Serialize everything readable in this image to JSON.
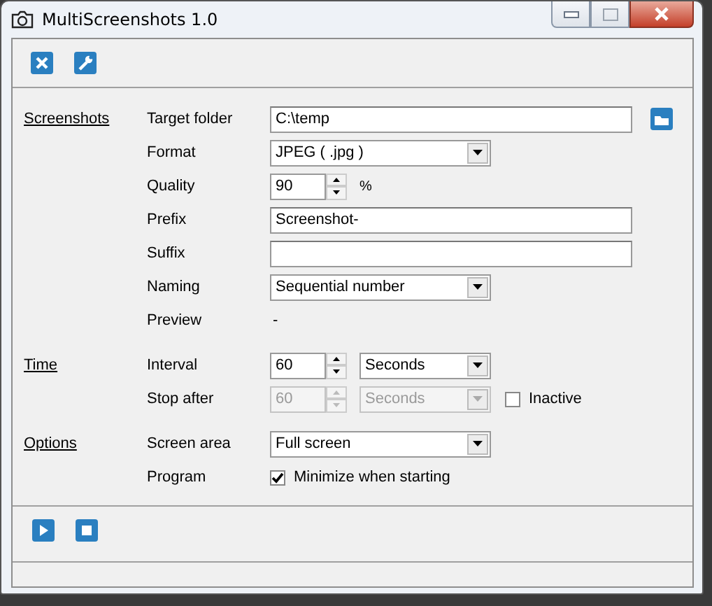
{
  "window": {
    "title": "MultiScreenshots 1.0"
  },
  "sections": [
    {
      "title": "Screenshots",
      "rows": [
        {
          "label": "Target folder",
          "controls": [
            {
              "kind": "text",
              "value": "C:\\temp"
            },
            {
              "kind": "browse"
            }
          ]
        },
        {
          "label": "Format",
          "controls": [
            {
              "kind": "select",
              "value": "JPEG ( .jpg )",
              "disabled": false
            }
          ]
        },
        {
          "label": "Quality",
          "controls": [
            {
              "kind": "spinner",
              "value": "90",
              "disabled": false
            },
            {
              "kind": "unit",
              "text": "%"
            }
          ]
        },
        {
          "label": "Prefix",
          "controls": [
            {
              "kind": "text",
              "value": "Screenshot-"
            }
          ]
        },
        {
          "label": "Suffix",
          "controls": [
            {
              "kind": "text"
            }
          ]
        },
        {
          "label": "Naming",
          "controls": [
            {
              "kind": "select",
              "value": "Sequential number",
              "disabled": false
            }
          ]
        },
        {
          "label": "Preview",
          "controls": [
            {
              "kind": "static",
              "text": "-"
            }
          ]
        }
      ]
    },
    {
      "title": "Time",
      "rows": [
        {
          "label": "Interval",
          "controls": [
            {
              "kind": "spinner",
              "value": "60",
              "disabled": false
            },
            {
              "kind": "select",
              "value": "Seconds",
              "disabled": false
            }
          ]
        },
        {
          "label": "Stop after",
          "controls": [
            {
              "kind": "spinner",
              "value": "60",
              "disabled": true
            },
            {
              "kind": "select",
              "value": "Seconds",
              "disabled": true
            },
            {
              "kind": "checkbox",
              "text": "Inactive",
              "checked": false
            }
          ]
        }
      ]
    },
    {
      "title": "Options",
      "rows": [
        {
          "label": "Screen area",
          "controls": [
            {
              "kind": "select",
              "value": "Full screen",
              "disabled": false
            }
          ]
        },
        {
          "label": "Program",
          "controls": [
            {
              "kind": "checkbox",
              "text": "Minimize when starting",
              "checked": true
            }
          ]
        }
      ]
    }
  ]
}
